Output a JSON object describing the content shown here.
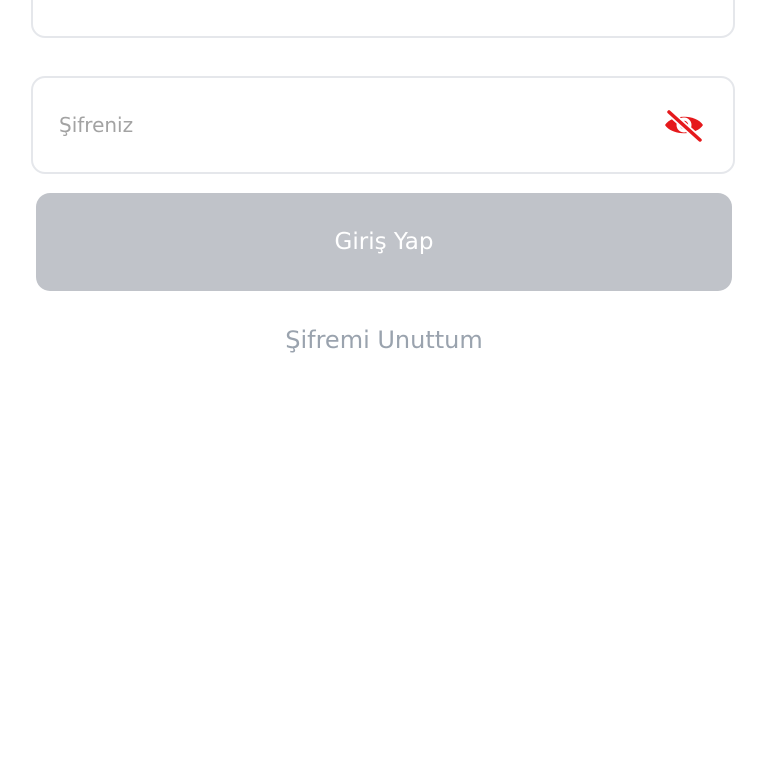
{
  "login_form": {
    "previous_field": {
      "value": ""
    },
    "password": {
      "placeholder": "Şifreniz",
      "value": "",
      "visibility_icon": "eye-slash-icon",
      "visibility_icon_color": "#e5191c"
    },
    "submit": {
      "label": "Giriş Yap",
      "background_color": "#c0c3c9",
      "text_color": "#ffffff",
      "state": "disabled"
    },
    "forgot_password": {
      "label": "Şifremi Unuttum",
      "color": "#9aa3ae"
    }
  }
}
